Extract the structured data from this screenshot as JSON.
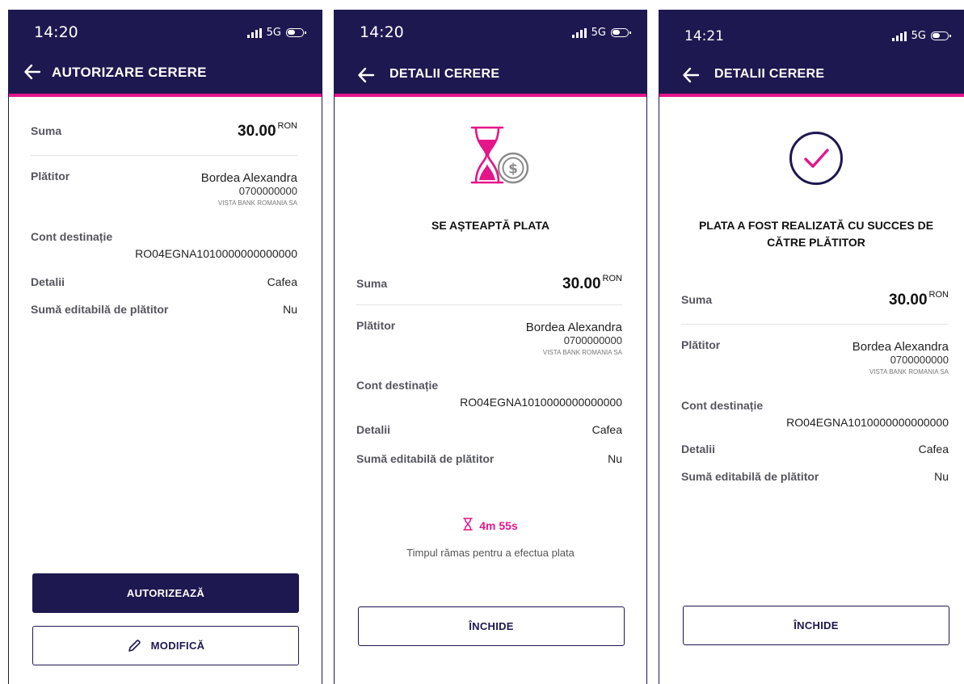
{
  "colors": {
    "primary": "#1e1850",
    "accent": "#e5158a"
  },
  "screens": [
    {
      "time": "14:20",
      "network": "5G",
      "title": "AUTORIZARE CERERE",
      "fields": {
        "amount_label": "Suma",
        "amount_value": "30.00",
        "currency": "RON",
        "payer_label": "Plătitor",
        "payer_name": "Bordea Alexandra",
        "payer_phone": "0700000000",
        "payer_bank": "VISTA BANK ROMANIA SA",
        "account_label": "Cont destinație",
        "account_value": "RO04EGNA1010000000000000",
        "details_label": "Detalii",
        "details_value": "Cafea",
        "editable_label": "Sumă editabilă de plătitor",
        "editable_value": "Nu"
      },
      "authorize_button": "AUTORIZEAZĂ",
      "modify_button": "MODIFICĂ"
    },
    {
      "time": "14:20",
      "network": "5G",
      "title": "DETALII CERERE",
      "status_icon": "hourglass-coin-icon",
      "status_text": "SE AȘTEAPTĂ PLATA",
      "fields": {
        "amount_label": "Suma",
        "amount_value": "30.00",
        "currency": "RON",
        "payer_label": "Plătitor",
        "payer_name": "Bordea Alexandra",
        "payer_phone": "0700000000",
        "payer_bank": "VISTA BANK ROMANIA SA",
        "account_label": "Cont destinație",
        "account_value": "RO04EGNA1010000000000000",
        "details_label": "Detalii",
        "details_value": "Cafea",
        "editable_label": "Sumă editabilă de plătitor",
        "editable_value": "Nu"
      },
      "timer": "4m 55s",
      "timer_caption": "Timpul rămas pentru a efectua plata",
      "close_button": "ÎNCHIDE"
    },
    {
      "time": "14:21",
      "network": "5G",
      "title": "DETALII CERERE",
      "status_icon": "check-circle-icon",
      "status_text_line1": "PLATA A FOST REALIZATĂ CU SUCCES DE",
      "status_text_line2": "CĂTRE PLĂTITOR",
      "fields": {
        "amount_label": "Suma",
        "amount_value": "30.00",
        "currency": "RON",
        "payer_label": "Plătitor",
        "payer_name": "Bordea Alexandra",
        "payer_phone": "0700000000",
        "payer_bank": "VISTA BANK ROMANIA SA",
        "account_label": "Cont destinație",
        "account_value": "RO04EGNA1010000000000000",
        "details_label": "Detalii",
        "details_value": "Cafea",
        "editable_label": "Sumă editabilă de plătitor",
        "editable_value": "Nu"
      },
      "close_button": "ÎNCHIDE"
    }
  ]
}
